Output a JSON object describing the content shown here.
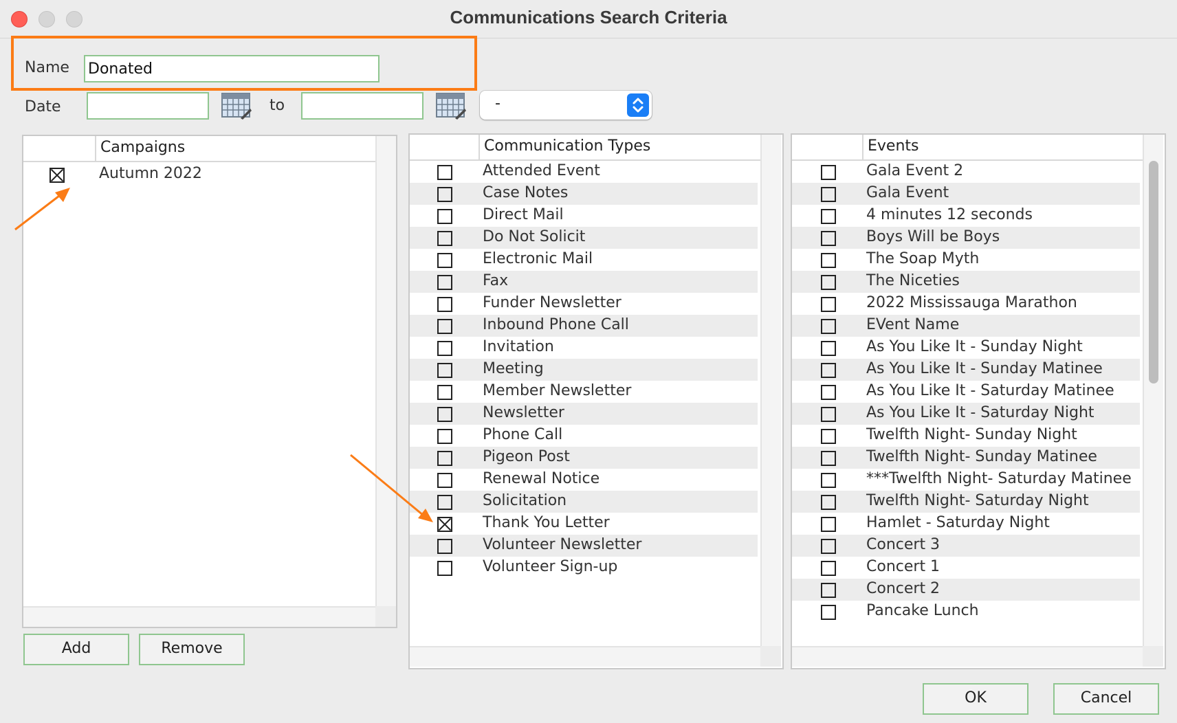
{
  "window": {
    "title": "Communications Search Criteria"
  },
  "name_field": {
    "label": "Name",
    "value": "Donated"
  },
  "date_field": {
    "label": "Date",
    "from_value": "",
    "to_label": "to",
    "to_value": ""
  },
  "range_select": {
    "value": "-"
  },
  "campaigns": {
    "header": "Campaigns",
    "items": [
      {
        "label": "Autumn 2022",
        "checked": true
      }
    ],
    "add_label": "Add",
    "remove_label": "Remove"
  },
  "comm_types": {
    "header": "Communication Types",
    "items": [
      {
        "label": "Attended Event",
        "checked": false
      },
      {
        "label": "Case Notes",
        "checked": false
      },
      {
        "label": "Direct Mail",
        "checked": false
      },
      {
        "label": "Do Not Solicit",
        "checked": false
      },
      {
        "label": "Electronic Mail",
        "checked": false
      },
      {
        "label": "Fax",
        "checked": false
      },
      {
        "label": "Funder Newsletter",
        "checked": false
      },
      {
        "label": "Inbound Phone Call",
        "checked": false
      },
      {
        "label": "Invitation",
        "checked": false
      },
      {
        "label": "Meeting",
        "checked": false
      },
      {
        "label": "Member Newsletter",
        "checked": false
      },
      {
        "label": "Newsletter",
        "checked": false
      },
      {
        "label": "Phone Call",
        "checked": false
      },
      {
        "label": "Pigeon Post",
        "checked": false
      },
      {
        "label": "Renewal Notice",
        "checked": false
      },
      {
        "label": "Solicitation",
        "checked": false
      },
      {
        "label": "Thank You Letter",
        "checked": true
      },
      {
        "label": "Volunteer Newsletter",
        "checked": false
      },
      {
        "label": "Volunteer Sign-up",
        "checked": false
      }
    ]
  },
  "events": {
    "header": "Events",
    "items": [
      {
        "label": "Gala Event 2",
        "checked": false
      },
      {
        "label": "Gala Event",
        "checked": false
      },
      {
        "label": "4 minutes 12 seconds",
        "checked": false
      },
      {
        "label": "Boys Will be Boys",
        "checked": false
      },
      {
        "label": "The Soap Myth",
        "checked": false
      },
      {
        "label": "The Niceties",
        "checked": false
      },
      {
        "label": "2022 Mississauga Marathon",
        "checked": false
      },
      {
        "label": "EVent Name",
        "checked": false
      },
      {
        "label": "As You Like It - Sunday Night",
        "checked": false
      },
      {
        "label": "As You Like It - Sunday Matinee",
        "checked": false
      },
      {
        "label": "As You Like It - Saturday Matinee",
        "checked": false
      },
      {
        "label": "As You Like It - Saturday Night",
        "checked": false
      },
      {
        "label": "Twelfth Night- Sunday Night",
        "checked": false
      },
      {
        "label": "Twelfth Night- Sunday Matinee",
        "checked": false
      },
      {
        "label": "***Twelfth Night- Saturday Matinee",
        "checked": false
      },
      {
        "label": "Twelfth Night- Saturday Night",
        "checked": false
      },
      {
        "label": "Hamlet - Saturday Night",
        "checked": false
      },
      {
        "label": "Concert 3",
        "checked": false
      },
      {
        "label": "Concert 1",
        "checked": false
      },
      {
        "label": "Concert 2",
        "checked": false
      },
      {
        "label": "Pancake Lunch",
        "checked": false
      }
    ]
  },
  "footer": {
    "ok_label": "OK",
    "cancel_label": "Cancel"
  },
  "colors": {
    "accent": "#fb7c16",
    "field_border": "#8fc68f",
    "select_blue": "#1a7ef6"
  },
  "icons": [
    "calendar-icon",
    "stepper-chevrons-icon",
    "annotation-arrow"
  ]
}
